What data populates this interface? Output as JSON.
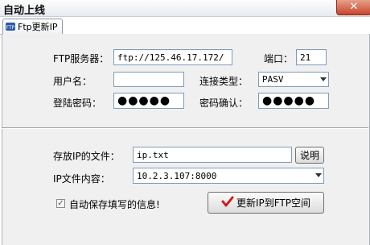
{
  "window": {
    "title": "自动上线",
    "close_glyph": "✕"
  },
  "tab": {
    "label": "Ftp更新IP",
    "icon": "ftp-icon"
  },
  "ftp": {
    "server_label": "FTP服务器：",
    "server_value": "ftp://125.46.17.172/",
    "port_label": "端口：",
    "port_value": "21",
    "user_label": "用户名：",
    "user_value": "",
    "conn_type_label": "连接类型：",
    "conn_type_value": "PASV",
    "password_label": "登陆密码：",
    "password_mask": "●●●●●",
    "confirm_label": "密码确认：",
    "confirm_mask": "●●●●●"
  },
  "ipfile": {
    "file_label": "存放IP的文件：",
    "file_value": "ip.txt",
    "explain_button": "说明",
    "content_label": "IP文件内容：",
    "content_value": "10.2.3.107:8000",
    "autosave_label": "自动保存填写的信息!",
    "autosave_checked": true,
    "update_button": "更新IP到FTP空间",
    "update_icon": "red-check-icon"
  },
  "colors": {
    "check_red": "#d21c1c",
    "field_border": "#7f9db9"
  }
}
